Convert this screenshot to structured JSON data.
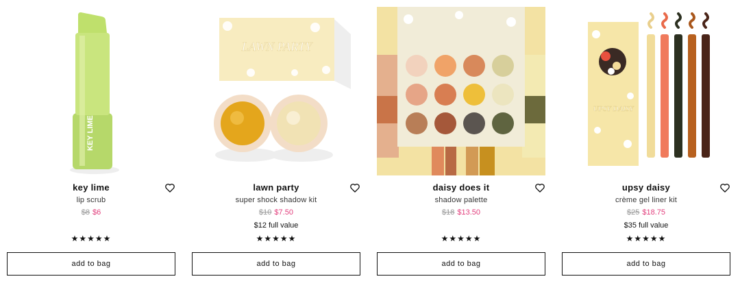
{
  "products": [
    {
      "name": "key lime",
      "subtitle": "lip scrub",
      "old_price": "$8",
      "new_price": "$6",
      "full_value": "",
      "rating": 5,
      "stars": "★★★★★",
      "button_label": "add to bag",
      "image_text": "KEY LIME",
      "icon": "heart-outline"
    },
    {
      "name": "lawn party",
      "subtitle": "super shock shadow kit",
      "old_price": "$10",
      "new_price": "$7.50",
      "full_value": "$12 full value",
      "rating": 5,
      "stars": "★★★★★",
      "button_label": "add to bag",
      "image_text": "LAWN PARTY",
      "icon": "heart-outline"
    },
    {
      "name": "daisy does it",
      "subtitle": "shadow palette",
      "old_price": "$18",
      "new_price": "$13.50",
      "full_value": "",
      "rating": 5,
      "stars": "★★★★★",
      "button_label": "add to bag",
      "image_text": "",
      "icon": "heart-outline"
    },
    {
      "name": "upsy daisy",
      "subtitle": "crème gel liner kit",
      "old_price": "$25",
      "new_price": "$18.75",
      "full_value": "$35 full value",
      "rating": 5,
      "stars": "★★★★★",
      "button_label": "add to bag",
      "image_text": "UPSY DAISY",
      "icon": "heart-outline"
    }
  ],
  "colors": {
    "sale": "#e23e7c",
    "strike": "#9a9a9a",
    "lime": "#c6e67a",
    "palette_bg": "#f6e7a6"
  }
}
